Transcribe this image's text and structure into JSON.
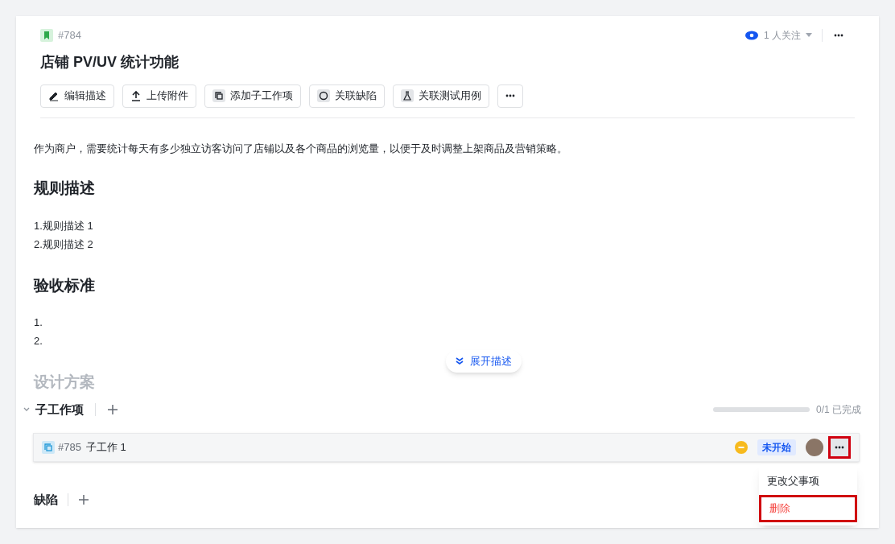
{
  "header": {
    "id": "#784",
    "title": "店铺 PV/UV 统计功能",
    "watchers": "1 人关注"
  },
  "toolbar": [
    {
      "label": "编辑描述",
      "kind": "edit"
    },
    {
      "label": "上传附件",
      "kind": "upload"
    },
    {
      "label": "添加子工作项",
      "kind": "subtask"
    },
    {
      "label": "关联缺陷",
      "kind": "bug"
    },
    {
      "label": "关联测试用例",
      "kind": "test"
    },
    {
      "kind": "more"
    }
  ],
  "description": {
    "intro": "作为商户，需要统计每天有多少独立访客访问了店铺以及各个商品的浏览量，以便于及时调整上架商品及营销策略。",
    "sections": [
      {
        "heading": "规则描述",
        "lines": [
          "1.规则描述 1",
          "2.规则描述 2"
        ]
      },
      {
        "heading": "验收标准",
        "lines": [
          "1.",
          "2."
        ]
      }
    ],
    "faded_heading": "设计方案",
    "expand_label": "展开描述"
  },
  "subtasks": {
    "title": "子工作项",
    "expanded": true,
    "progress": "0/1 已完成",
    "items": [
      {
        "id": "#785",
        "name": "子工作 1",
        "status": "未开始",
        "more_highlighted": true,
        "menu": [
          {
            "label": "更改父事项",
            "danger": false,
            "highlighted": false
          },
          {
            "label": "删除",
            "danger": true,
            "highlighted": true
          }
        ]
      }
    ]
  },
  "bugs": {
    "title": "缺陷"
  }
}
